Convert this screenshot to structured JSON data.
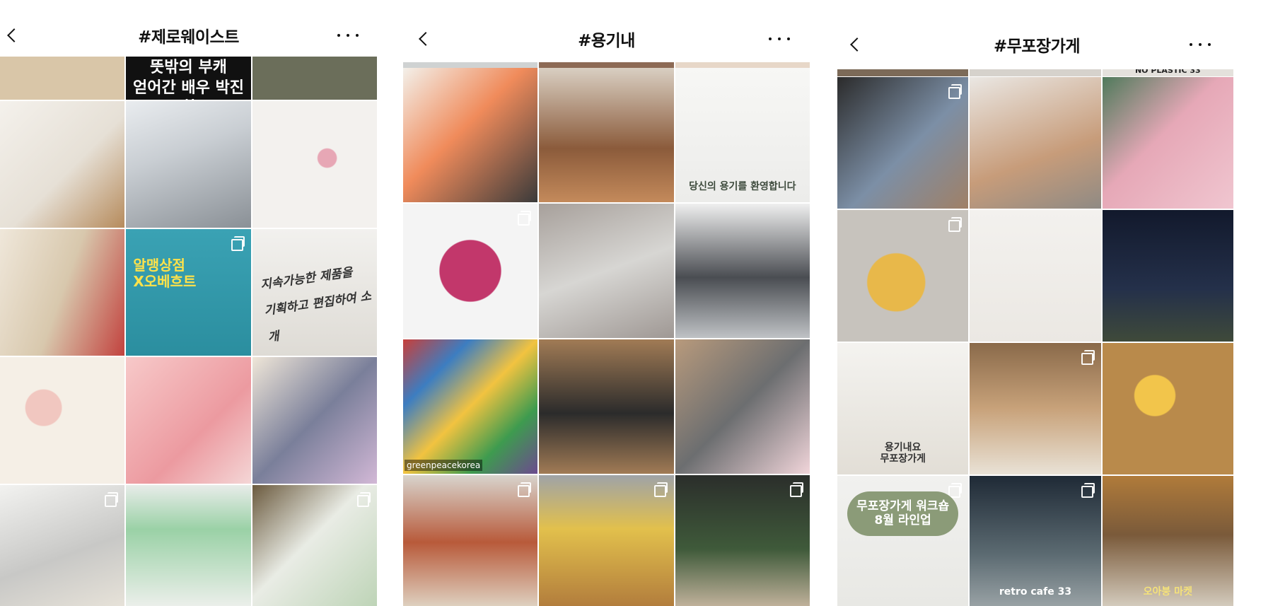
{
  "panels": [
    {
      "id": "zero-waste",
      "title": "#제로웨이스트",
      "top_strip": [
        "#d9c6a8",
        "#2a2a2a",
        "#6b6e5a"
      ],
      "top_strip_text": "뜻밖의 부캐\n얻어간 배우 박진희",
      "tiles": [
        {
          "name": "wrapped-package",
          "bg": "linear-gradient(135deg,#f4f1ec 0%,#e6e0d6 55%,#b68b5c 100%)",
          "multi": false
        },
        {
          "name": "kitchen-sink",
          "bg": "linear-gradient(160deg,#e9ecef 0%,#c9ced3 40%,#8a9096 100%)",
          "multi": false
        },
        {
          "name": "pink-soap-dishes",
          "bg": "radial-gradient(circle at 60% 45%,#e7a7b5 0 9%,#f3f1ee 10% 100%)",
          "multi": false
        },
        {
          "name": "bread-on-rack",
          "bg": "linear-gradient(110deg,#efe7da 0%,#d8c8ad 50%,#c2423e 100%)",
          "multi": false
        },
        {
          "name": "donut-stack-poster",
          "bg": "linear-gradient(180deg,#3aa2b4 0%,#2b8e9f 100%)",
          "multi": true,
          "text": "알맹상점\nX오베흐트",
          "text_color": "#ffe24a"
        },
        {
          "name": "handwritten-note",
          "bg": "linear-gradient(180deg,#f2f1ee 0%,#dedbd5 100%)",
          "multi": false,
          "hand": "지속가능한 제품을\n기획하고 편집하여 소개"
        },
        {
          "name": "colorful-soap-bars",
          "bg": "radial-gradient(circle at 35% 40%,#f1c7c0 0 16%,#f5efe6 17% 100%)",
          "multi": false
        },
        {
          "name": "pink-shampoo-pieces",
          "bg": "linear-gradient(135deg,#f7c9c9 0%,#ec9aa0 60%,#f4d6d6 100%)",
          "multi": false
        },
        {
          "name": "marbled-soap-box",
          "bg": "linear-gradient(135deg,#efe6d8 0%,#7a7f9a 50%,#d2b8d6 100%)",
          "multi": false
        },
        {
          "name": "steel-tumbler",
          "bg": "linear-gradient(160deg,#f2f2f0 0%,#c8c8c6 55%,#e9e4da 100%)",
          "multi": true
        },
        {
          "name": "green-packaging",
          "bg": "linear-gradient(180deg,#e8ece9 0%,#9ad1a6 35%,#f1f1ef 100%)",
          "multi": false
        },
        {
          "name": "beeswax-wraps",
          "bg": "linear-gradient(135deg,#6b5a3e 0%,#e9ece5 45%,#bcd3b5 100%)",
          "multi": true
        }
      ]
    },
    {
      "id": "yonggi-nae",
      "title": "#용기내",
      "top_strip": [
        "#cfd2d2",
        "#8d6a55",
        "#e7d7c8"
      ],
      "tiles": [
        {
          "name": "salmon-containers",
          "bg": "linear-gradient(135deg,#f3f0ea 0%,#f08b5b 45%,#3a3a3a 100%)",
          "multi": false
        },
        {
          "name": "cafe-table-vase",
          "bg": "linear-gradient(180deg,#d9cfc2 0%,#8b5b3b 60%,#c48a5b 100%)",
          "multi": false
        },
        {
          "name": "courage-tote-print",
          "bg": "linear-gradient(180deg,#f7f7f5 0%,#ececea 100%)",
          "multi": false,
          "text": "당신의 용기를 환영합니다",
          "text_color": "#3d4a3c",
          "small": true
        },
        {
          "name": "beet-smoothie-bowl",
          "bg": "radial-gradient(circle at 50% 50%,#c2376b 0 32%,#f4f4f4 33% 100%)",
          "multi": true
        },
        {
          "name": "mesh-net-bag",
          "bg": "linear-gradient(160deg,#a7a09b 0%,#d7d6d3 50%,#9f9894 100%)",
          "multi": false
        },
        {
          "name": "espresso-machine",
          "bg": "linear-gradient(180deg,#efefef 0%,#4a4d52 55%,#bfc2c5 100%)",
          "multi": false
        },
        {
          "name": "plastic-waste-pile",
          "bg": "linear-gradient(135deg,#c83f3a 0%,#3c7dc1 25%,#f2c340 50%,#3e9b4f 75%,#6c4a8f 100%)",
          "multi": false,
          "watermark": "greenpeacekorea"
        },
        {
          "name": "cookies-in-container",
          "bg": "linear-gradient(180deg,#a17b55 0%,#2b2b2b 55%,#a17b55 100%)",
          "multi": false
        },
        {
          "name": "tumblers-and-macarons",
          "bg": "linear-gradient(135deg,#b89a7c 0%,#6c6e70 50%,#f1d5da 100%)",
          "multi": false
        },
        {
          "name": "mushroom-soup",
          "bg": "linear-gradient(180deg,#d8d4cd 0%,#b85a3a 50%,#e0d6c6 100%)",
          "multi": true
        },
        {
          "name": "burger-fries-box",
          "bg": "linear-gradient(180deg,#9fa3a7 0%,#e2c04c 40%,#b07a3c 100%)",
          "multi": true
        },
        {
          "name": "christmas-tree",
          "bg": "linear-gradient(180deg,#2b2e2b 0%,#3f5a3a 55%,#c7b6a0 100%)",
          "multi": true
        }
      ]
    },
    {
      "id": "mupojang-store",
      "title": "#무포장가게",
      "top_strip": [
        "#7c6a58",
        "#d6d2cc",
        "#e4e1dc"
      ],
      "top_strip_text": "NO PLASTIC 33",
      "tiles": [
        {
          "name": "chalkboard-dispenser",
          "bg": "linear-gradient(135deg,#2b2b2b 0%,#7c8fa6 55%,#a08066 100%)",
          "multi": true
        },
        {
          "name": "green-tote-bag",
          "bg": "linear-gradient(160deg,#eae7e3 0%,#c79c7a 60%,#8f8a84 100%)",
          "multi": false
        },
        {
          "name": "pink-booklet",
          "bg": "linear-gradient(135deg,#4f7a5b 0%,#e6a8b7 45%,#f0c6d0 100%)",
          "multi": false
        },
        {
          "name": "bread-loaves",
          "bg": "radial-gradient(circle at 45% 55%,#e8b84a 0 28%,#c7c3bd 29% 100%)",
          "multi": true
        },
        {
          "name": "store-sign-shelf",
          "bg": "linear-gradient(180deg,#f3f1ee 0%,#ebe8e3 100%)",
          "multi": false
        },
        {
          "name": "night-tent",
          "bg": "linear-gradient(180deg,#12192c 0%,#24304a 60%,#3f4a3a 100%)",
          "multi": false
        },
        {
          "name": "shop-notice-board",
          "bg": "linear-gradient(180deg,#f4f3f0 0%,#e2ded6 100%)",
          "multi": false,
          "text": "용기내요\n무포장가게",
          "text_color": "#333",
          "small": true
        },
        {
          "name": "wicker-basket",
          "bg": "linear-gradient(180deg,#8a6a4a 0%,#c8a27a 50%,#e9e2d6 100%)",
          "multi": true
        },
        {
          "name": "egg-tarts",
          "bg": "radial-gradient(circle at 40% 40%,#f2c54b 0 18%,#b98a4b 19% 100%)",
          "multi": false
        },
        {
          "name": "workshop-poster",
          "bg": "linear-gradient(180deg,#f1f1ef 0%,#e8e8e4 100%)",
          "multi": true,
          "text": "무포장가게 워크숍\n8월 라인업",
          "text_color": "#ffffff",
          "bubble": true
        },
        {
          "name": "retro-cafe-night",
          "bg": "linear-gradient(180deg,#1f2a36 0%,#5c6b72 60%,#9aa3a6 100%)",
          "multi": true,
          "text": "retro cafe 33",
          "text_color": "#ffffff",
          "small": true
        },
        {
          "name": "outdoor-market-stall",
          "bg": "linear-gradient(180deg,#b07b3a 0%,#7a5a3a 45%,#d5cdbf 100%)",
          "multi": false,
          "text": "오아붕 마켓",
          "text_color": "#f5e27a",
          "small": true
        }
      ]
    }
  ]
}
